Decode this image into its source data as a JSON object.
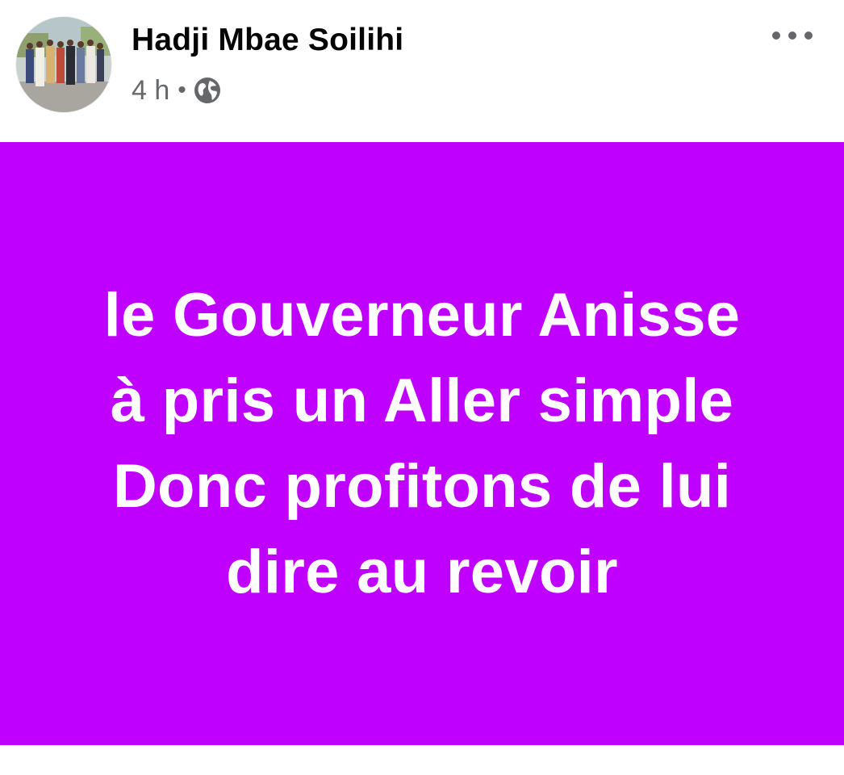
{
  "post": {
    "author": "Hadji Mbae Soilihi",
    "time": "4 h",
    "separator": "•",
    "privacy_icon": "globe-icon",
    "more_icon": "more-horizontal-icon",
    "image_background": "#bf00ff",
    "image_text_lines": [
      "le Gouverneur Anisse",
      "à pris un Aller simple",
      "Donc profitons de lui",
      "dire au revoir"
    ]
  }
}
